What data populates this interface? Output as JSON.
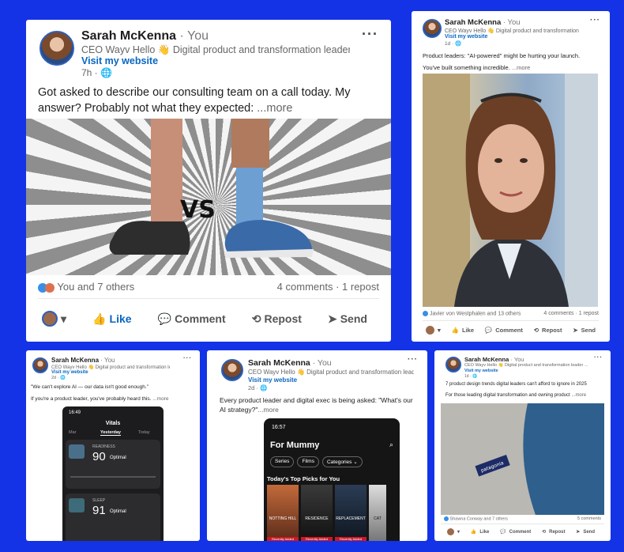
{
  "colors": {
    "background": "#1433e6",
    "link": "#0a66c2",
    "card": "#ffffff"
  },
  "author": {
    "name": "Sarah McKenna",
    "you": "· You",
    "visit": "Visit my website"
  },
  "posts": [
    {
      "headline": "CEO Wayv Hello 👋 Digital product and transformation leader ...",
      "time": "7h · 🌐",
      "text": "Got asked to describe our consulting team on a call today. My answer? Probably not what they expected:",
      "more": "...more",
      "image_text": "VS",
      "reactions": "You and 7 others",
      "comments": "4 comments · 1 repost",
      "actions": [
        "Like",
        "Comment",
        "Repost",
        "Send"
      ]
    },
    {
      "headline": "CEO Wayv Hello 👋 Digital product and transformation leader ...",
      "time": "1d · 🌐",
      "line1": "Product leaders: \"AI-powered\" might be hurting your launch.",
      "line2": "You've built something incredible.",
      "more": "...more",
      "reactions": "Javier von Westphalen and 13 others",
      "comments": "4 comments · 1 repost",
      "actions": [
        "Like",
        "Comment",
        "Repost",
        "Send"
      ]
    },
    {
      "headline": "CEO Wayv Hello 👋 Digital product and transformation leader ...",
      "time": "2d · 🌐",
      "line1": "\"We can't explore AI — our data isn't good enough.\"",
      "line2": "If you're a product leader, you've probably heard this.",
      "more": "...more",
      "phone": {
        "clock": "16:49",
        "title": "Vitals",
        "tab_left": "Mar",
        "tab_active": "Yesterday",
        "tab_right": "Today",
        "m1_label": "READINESS",
        "m1_value": "90",
        "m1_status": "Optimal",
        "m2_label": "SLEEP",
        "m2_value": "91",
        "m2_status": "Optimal"
      }
    },
    {
      "headline": "CEO Wayv Hello 👋 Digital product and transformation leader ...",
      "time": "2d · 🌐",
      "text": "Every product leader and digital exec is being asked: \"What's our AI strategy?\"",
      "more": "...more",
      "phone": {
        "clock": "16:57",
        "title": "For Mummy",
        "chips": [
          "Series",
          "Films",
          "Categories ⌄"
        ],
        "section": "Today's Top Picks for You",
        "posters": [
          "NOTTING HILL",
          "RESIDENCE",
          "REPLACEMENT",
          "CAT"
        ],
        "badge": "Recently Added"
      }
    },
    {
      "headline": "CEO Wayv Hello 👋 Digital product and transformation leader ...",
      "time": "1d · 🌐",
      "line1": "7 product design trends digital leaders can't afford to ignore in 2025",
      "line2": "For those leading digital transformation and owning product",
      "more": "...more",
      "image_text": "patagonia",
      "reactions": "Shawna Conway and 7 others",
      "comments": "5 comments",
      "actions": [
        "Like",
        "Comment",
        "Repost",
        "Send"
      ]
    }
  ]
}
